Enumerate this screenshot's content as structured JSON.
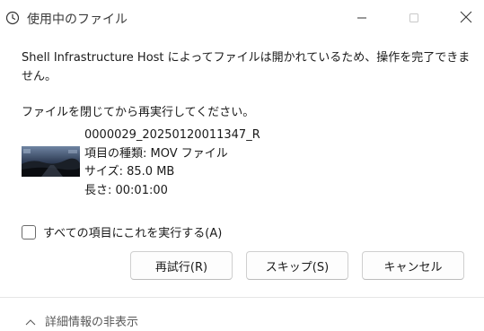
{
  "window": {
    "title": "使用中のファイル",
    "title_icon": "clock-icon",
    "controls": {
      "minimize": "minimize-icon",
      "maximize": "maximize-icon",
      "close": "close-icon"
    }
  },
  "dialog": {
    "message": "Shell Infrastructure Host によってファイルは開かれているため、操作を完了できません。",
    "instruction": "ファイルを閉じてから再実行してください。",
    "file": {
      "name": "0000029_20250120011347_R",
      "type_line": "項目の種類: MOV ファイル",
      "size_line": "サイズ: 85.0 MB",
      "length_line": "長さ: 00:01:00"
    },
    "apply_all": {
      "label": "すべての項目にこれを実行する(A)",
      "checked": false
    },
    "buttons": {
      "retry": "再試行(R)",
      "skip": "スキップ(S)",
      "cancel": "キャンセル"
    },
    "details_toggle": {
      "label": "詳細情報の非表示",
      "icon": "chevron-up-icon"
    }
  },
  "colors": {
    "accent": "#1a1a1a",
    "background": "#ffffff",
    "divider": "#e5e5e5"
  }
}
